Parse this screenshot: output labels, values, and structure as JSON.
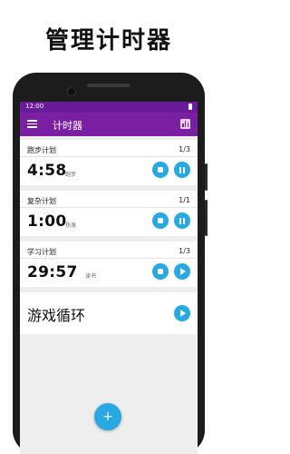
{
  "headline": "管理计时器",
  "status_bar": {
    "time": "12:00"
  },
  "app_bar": {
    "title": "计时器"
  },
  "timers": [
    {
      "name": "跑步计划",
      "counter": "1/3",
      "time": "4:58",
      "activity": "跑步",
      "state": "running"
    },
    {
      "name": "复杂计划",
      "counter": "1/1",
      "time": "1:00",
      "activity": "热身",
      "state": "running"
    },
    {
      "name": "学习计划",
      "counter": "1/3",
      "time": "29:57",
      "activity": "读书",
      "state": "paused"
    }
  ],
  "loop_item": {
    "title": "游戏循环"
  },
  "fab": {
    "label": "+"
  },
  "colors": {
    "app_bar": "#7b1fa2",
    "status_bar": "#6a1b9a",
    "accent": "#29a9e1"
  },
  "icons": {
    "menu": "menu-icon",
    "stats": "bar-chart-icon",
    "stop": "stop-icon",
    "pause": "pause-icon",
    "play": "play-icon",
    "add": "add-icon"
  }
}
